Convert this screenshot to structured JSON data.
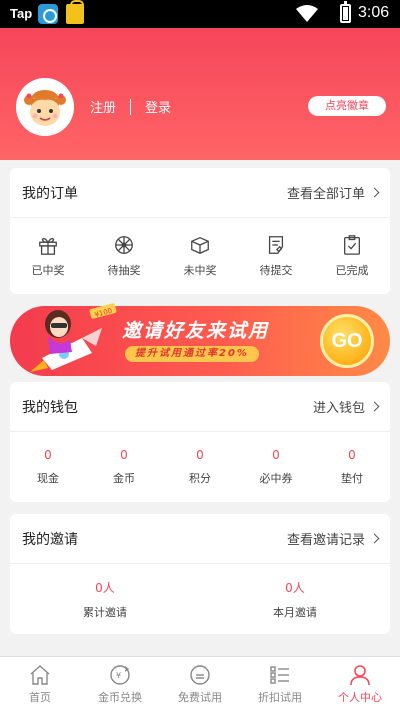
{
  "status_bar": {
    "left_text": "Tap",
    "time": "3:06"
  },
  "header": {
    "register": "注册",
    "login": "登录",
    "badge_button": "点亮徽章"
  },
  "orders": {
    "title": "我的订单",
    "more": "查看全部订单",
    "items": [
      {
        "label": "已中奖",
        "icon": "gift-icon"
      },
      {
        "label": "待抽奖",
        "icon": "wheel-icon"
      },
      {
        "label": "未中奖",
        "icon": "box-icon"
      },
      {
        "label": "待提交",
        "icon": "edit-list-icon"
      },
      {
        "label": "已完成",
        "icon": "clipboard-check-icon"
      }
    ]
  },
  "banner": {
    "main_text": "邀请好友来试用",
    "sub_text": "提升试用通过率20%",
    "go": "GO",
    "tag": "¥100"
  },
  "wallet": {
    "title": "我的钱包",
    "more": "进入钱包",
    "items": [
      {
        "value": "0",
        "label": "现金"
      },
      {
        "value": "0",
        "label": "金币"
      },
      {
        "value": "0",
        "label": "积分"
      },
      {
        "value": "0",
        "label": "必中券"
      },
      {
        "value": "0",
        "label": "垫付"
      }
    ]
  },
  "invite": {
    "title": "我的邀请",
    "more": "查看邀请记录",
    "items": [
      {
        "value": "0人",
        "label": "累计邀请"
      },
      {
        "value": "0人",
        "label": "本月邀请"
      }
    ]
  },
  "tabs": [
    {
      "label": "首页",
      "icon": "home-icon"
    },
    {
      "label": "金币兑换",
      "icon": "coin-exchange-icon"
    },
    {
      "label": "免费试用",
      "icon": "free-trial-icon"
    },
    {
      "label": "折扣试用",
      "icon": "discount-list-icon"
    },
    {
      "label": "个人中心",
      "icon": "user-icon",
      "active": true
    }
  ],
  "colors": {
    "accent": "#f5465a",
    "header": "#ff6466",
    "background": "#f2f2f2"
  }
}
